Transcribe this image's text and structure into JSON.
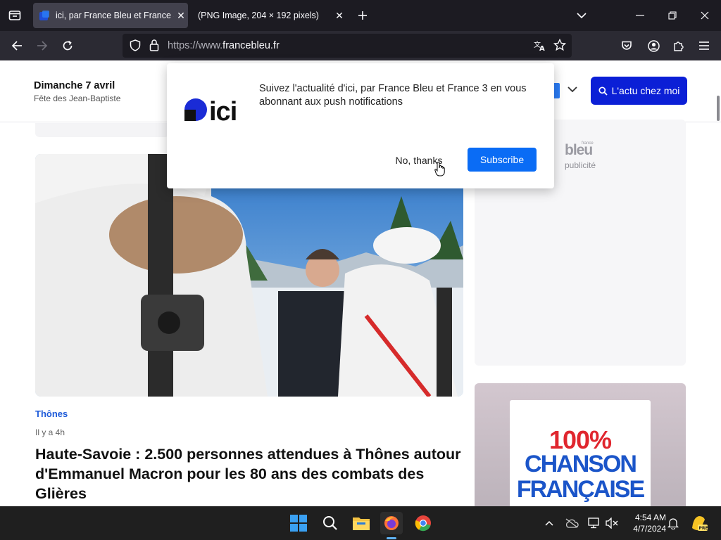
{
  "browser": {
    "tabs": [
      {
        "title": "ici, par France Bleu et France 3",
        "active": true
      },
      {
        "title": "(PNG Image, 204 × 192 pixels)",
        "active": false
      }
    ],
    "url_protocol": "https://www.",
    "url_domain": "francebleu.fr"
  },
  "site": {
    "date": "Dimanche 7 avril",
    "saint": "Fête des Jean-Baptiste",
    "actu_button": "L'actu chez moi"
  },
  "article": {
    "category": "Thônes",
    "time_ago": "Il y a 4h",
    "headline": "Haute-Savoie : 2.500 personnes attendues à Thônes autour d'Emmanuel Macron pour les 80 ans des combats des Glières"
  },
  "sidebar": {
    "ad_logo": "bleu",
    "ad_logo_small": "france",
    "ad_label": "publicité",
    "promo_line1": "100%",
    "promo_line2": "CHANSON",
    "promo_line3": "FRANÇAISE"
  },
  "popup": {
    "logo_text": "ici",
    "message": "Suivez l'actualité d'ici, par France Bleu et France 3 en vous abonnant aux push notifications",
    "no_thanks": "No, thanks",
    "subscribe": "Subscribe"
  },
  "taskbar": {
    "time": "4:54 AM",
    "date": "4/7/2024"
  },
  "colors": {
    "brand_blue": "#0b1fd6",
    "subscribe_blue": "#0a6cf5",
    "category_blue": "#1e5bd9"
  }
}
